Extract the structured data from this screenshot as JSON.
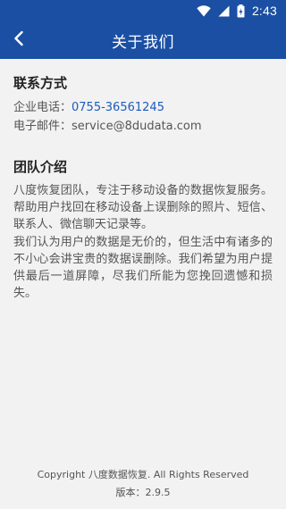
{
  "status_bar": {
    "time": "2:43",
    "icons": [
      "wifi-icon",
      "signal-icon",
      "battery-icon"
    ]
  },
  "app_bar": {
    "back_icon": "chevron-left-icon",
    "title": "关于我们"
  },
  "contact": {
    "heading": "联系方式",
    "phone_label": "企业电话：",
    "phone_value": "0755-36561245",
    "email_label": "电子邮件：",
    "email_value": "service@8dudata.com"
  },
  "team": {
    "heading": "团队介绍",
    "paragraph_1": "八度恢复团队，专注于移动设备的数据恢复服务。帮助用户找回在移动设备上误删除的照片、短信、联系人、微信聊天记录等。",
    "paragraph_2": "我们认为用户的数据是无价的，但生活中有诸多的不小心会讲宝贵的数据误删除。我们希望为用户提供最后一道屏障，尽我们所能为您挽回遗憾和损失。"
  },
  "footer": {
    "copyright": "Copyright 八度数据恢复. All Rights Reserved",
    "version": "版本：2.9.5"
  },
  "colors": {
    "primary": "#1b4fa3",
    "link": "#1b5bbf",
    "background": "#f2f2f2"
  }
}
